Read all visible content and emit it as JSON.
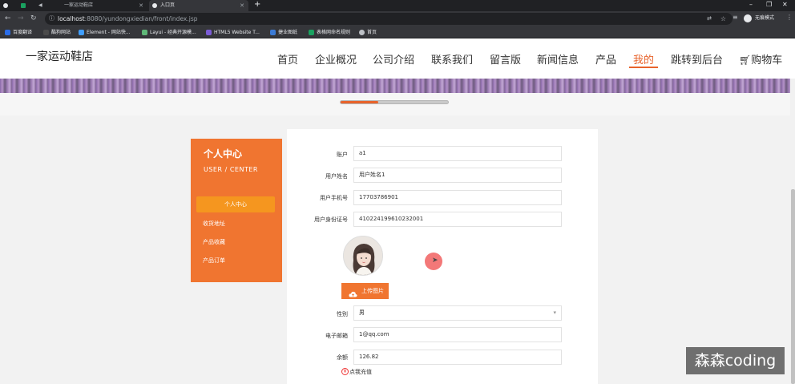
{
  "browser": {
    "tabs": [
      {
        "label": "",
        "active": false
      },
      {
        "label": "",
        "active": false
      },
      {
        "label": "",
        "active": false
      },
      {
        "label": "一家运动鞋店",
        "active": false
      },
      {
        "label": "入口页",
        "active": true
      }
    ],
    "new_tab": "+",
    "url_host": "localhost",
    "url_path": ":8080/yundongxiedian/front/index.jsp",
    "profile_label": "无痕模式",
    "bookmarks": [
      {
        "label": "百度翻译",
        "color": "#2b6de8"
      },
      {
        "label": "酷狗网站",
        "color": "#4a4a4a"
      },
      {
        "label": "Element - 网站快...",
        "color": "#409eff"
      },
      {
        "label": "Layui - 经典开源模...",
        "color": "#5fb878"
      },
      {
        "label": "HTML5 Website T...",
        "color": "#7b5cd6"
      },
      {
        "label": "捷业图纸",
        "color": "#3b7bd6"
      },
      {
        "label": "表格网命名规则",
        "color": "#1aa260"
      },
      {
        "label": "首页",
        "color": "#bdc1c6"
      }
    ]
  },
  "site": {
    "title": "一家运动鞋店",
    "nav": [
      "首页",
      "企业概况",
      "公司介绍",
      "联系我们",
      "留言版",
      "新闻信息",
      "产品",
      "我的",
      "跳转到后台",
      "购物车"
    ],
    "active_nav": "我的",
    "accent": "#e8632b",
    "banner_progress": 0.35
  },
  "sidebar": {
    "title": "个人中心",
    "subtitle": "USER / CENTER",
    "active_item": "个人中心",
    "items": [
      "收货地址",
      "产品收藏",
      "产品订单"
    ]
  },
  "form": {
    "account_label": "账户",
    "account_value": "a1",
    "name_label": "用户姓名",
    "name_value": "用户姓名1",
    "phone_label": "用户手机号",
    "phone_value": "17703786901",
    "idcard_label": "用户身份证号",
    "idcard_value": "410224199610232001",
    "upload_label": "上传图片",
    "gender_label": "性别",
    "gender_value": "男",
    "email_label": "电子邮箱",
    "email_value": "1@qq.com",
    "balance_label": "余额",
    "balance_value": "126.82",
    "recharge_label": "点我充值",
    "recharge_icon": "¥"
  },
  "watermark": "森森coding"
}
